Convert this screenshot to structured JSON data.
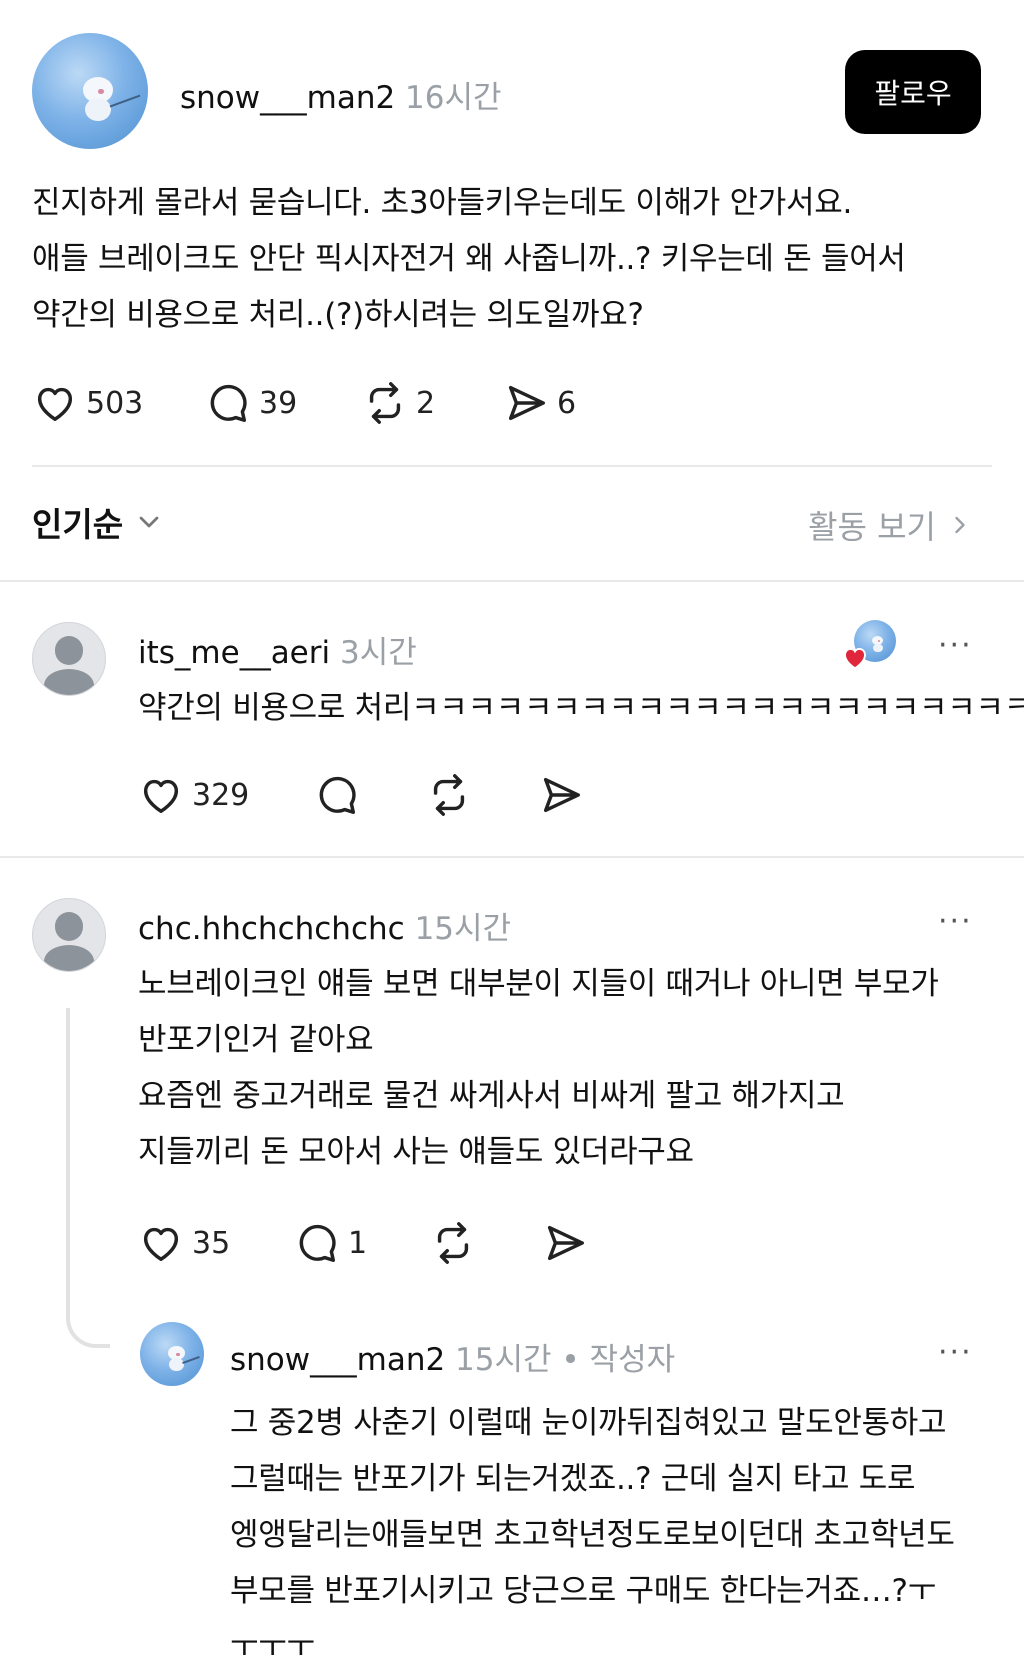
{
  "post": {
    "username": "snow___man2",
    "time": "16시간",
    "follow_label": "팔로우",
    "lines": [
      "진지하게 몰라서 묻습니다. 초3아들키우는데도 이해가 안가서요.",
      "애들 브레이크도 안단 픽시자전거 왜 사줍니까..? 키우는데 돈 들어서",
      "약간의 비용으로 처리..(?)하시려는 의도일까요?"
    ],
    "likes": "503",
    "comments": "39",
    "reposts": "2",
    "shares": "6"
  },
  "sort": {
    "label": "인기순",
    "activity_label": "활동 보기"
  },
  "replies": [
    {
      "username": "its_me__aeri",
      "time": "3시간",
      "lines": [
        "약간의 비용으로 처리ㅋㅋㅋㅋㅋㅋㅋㅋㅋㅋㅋㅋㅋㅋㅋㅋㅋㅋㅋㅋㅋㅋㅋ"
      ],
      "likes": "329",
      "comments": "",
      "more": "···"
    },
    {
      "username": "chc.hhchchchchc",
      "time": "15시간",
      "lines": [
        "노브레이크인 얘들 보면 대부분이 지들이 때거나 아니면 부모가",
        "반포기인거 같아요",
        "요즘엔 중고거래로 물건 싸게사서 비싸게 팔고 해가지고",
        "지들끼리 돈 모아서 사는 얘들도 있더라구요"
      ],
      "likes": "35",
      "comments": "1",
      "more": "···"
    },
    {
      "username": "snow___man2",
      "time": "15시간",
      "author_badge": "• 작성자",
      "lines": [
        "그 중2병 사춘기 이럴때 눈이까뒤집혀있고 말도안통하고",
        "그럴때는 반포기가 되는거겠죠..? 근데 실지 타고 도로",
        "엥앵달리는애들보면 초고학년정도로보이던대 초고학년도",
        "부모를 반포기시키고 당근으로 구매도 한다는거죠…?ㅜ",
        "ㅜㅜㅜ"
      ],
      "more": "···"
    }
  ],
  "colors": {
    "accent_heart": "#e0263a",
    "button_bg": "#000000",
    "muted_text": "#9aa0a6"
  },
  "icons": [
    "heart-icon",
    "comment-icon",
    "repost-icon",
    "share-icon",
    "chevron-down-icon",
    "chevron-right-icon",
    "more-icon"
  ]
}
